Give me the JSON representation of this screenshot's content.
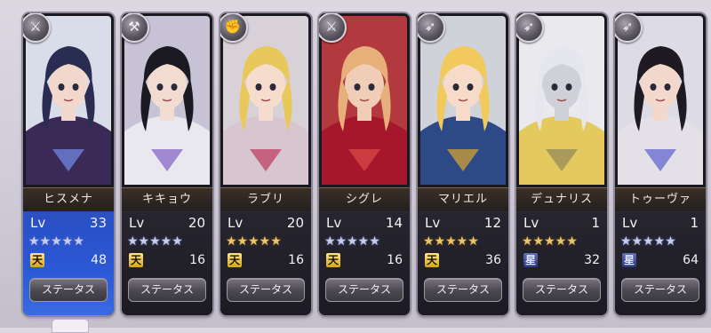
{
  "characters": [
    {
      "name": "ヒスメナ",
      "lv_label": "Lv",
      "lv": "33",
      "stars": "★★★★★",
      "star_color": "silver",
      "rank_glyph": "天",
      "rank_type": "ten",
      "rank_value": "48",
      "button": "ステータス",
      "type_icon": "sword-icon",
      "panel": "blue",
      "palette": {
        "hair": "#2a2d52",
        "skin": "#f1d7cc",
        "outfit": "#3b2a58",
        "accent": "#6f7fd8",
        "bg": "#d9dce9"
      }
    },
    {
      "name": "キキョウ",
      "lv_label": "Lv",
      "lv": "20",
      "stars": "★★★★★",
      "star_color": "silver",
      "rank_glyph": "天",
      "rank_type": "ten",
      "rank_value": "16",
      "button": "ステータス",
      "type_icon": "hammer-icon",
      "panel": "dark",
      "palette": {
        "hair": "#1b1a22",
        "skin": "#f2dbd0",
        "outfit": "#e9e8ef",
        "accent": "#8e6fc8",
        "bg": "#c7c2d6"
      }
    },
    {
      "name": "ラブリ",
      "lv_label": "Lv",
      "lv": "20",
      "stars": "★★★★★",
      "star_color": "gold",
      "rank_glyph": "天",
      "rank_type": "ten",
      "rank_value": "16",
      "button": "ステータス",
      "type_icon": "fist-icon",
      "panel": "dark",
      "palette": {
        "hair": "#e8c85a",
        "skin": "#f6dccd",
        "outfit": "#d7c6cf",
        "accent": "#c0486c",
        "bg": "#d8d1d8"
      }
    },
    {
      "name": "シグレ",
      "lv_label": "Lv",
      "lv": "14",
      "stars": "★★★★★",
      "star_color": "silver",
      "rank_glyph": "天",
      "rank_type": "ten",
      "rank_value": "16",
      "button": "ステータス",
      "type_icon": "sword-icon",
      "panel": "dark",
      "palette": {
        "hair": "#e7b07a",
        "skin": "#f0cdb6",
        "outfit": "#a7172b",
        "accent": "#d64545",
        "bg": "#b23a3f"
      }
    },
    {
      "name": "マリエル",
      "lv_label": "Lv",
      "lv": "12",
      "stars": "★★★★★",
      "star_color": "gold",
      "rank_glyph": "天",
      "rank_type": "ten",
      "rank_value": "36",
      "button": "ステータス",
      "type_icon": "bow-icon",
      "panel": "dark",
      "palette": {
        "hair": "#f1c95c",
        "skin": "#f5dbc8",
        "outfit": "#2d4a86",
        "accent": "#c79a3a",
        "bg": "#cfd2d9"
      }
    },
    {
      "name": "デュナリス",
      "lv_label": "Lv",
      "lv": "1",
      "stars": "★★★★★",
      "star_color": "gold",
      "rank_glyph": "星",
      "rank_type": "sei",
      "rank_value": "32",
      "button": "ステータス",
      "type_icon": "bow-icon",
      "panel": "dark",
      "palette": {
        "hair": "#e6e6ee",
        "skin": "#cfd0d8",
        "outfit": "#e4c95e",
        "accent": "#9a8d5a",
        "bg": "#e9e9ee"
      }
    },
    {
      "name": "トゥーヴァ",
      "lv_label": "Lv",
      "lv": "1",
      "stars": "★★★★★",
      "star_color": "silver",
      "rank_glyph": "星",
      "rank_type": "sei",
      "rank_value": "64",
      "button": "ステータス",
      "type_icon": "bow-icon",
      "panel": "dark",
      "palette": {
        "hair": "#1f1a22",
        "skin": "#f3d8cc",
        "outfit": "#e3e0e8",
        "accent": "#6b6fd0",
        "bg": "#dcdbe6"
      }
    }
  ]
}
